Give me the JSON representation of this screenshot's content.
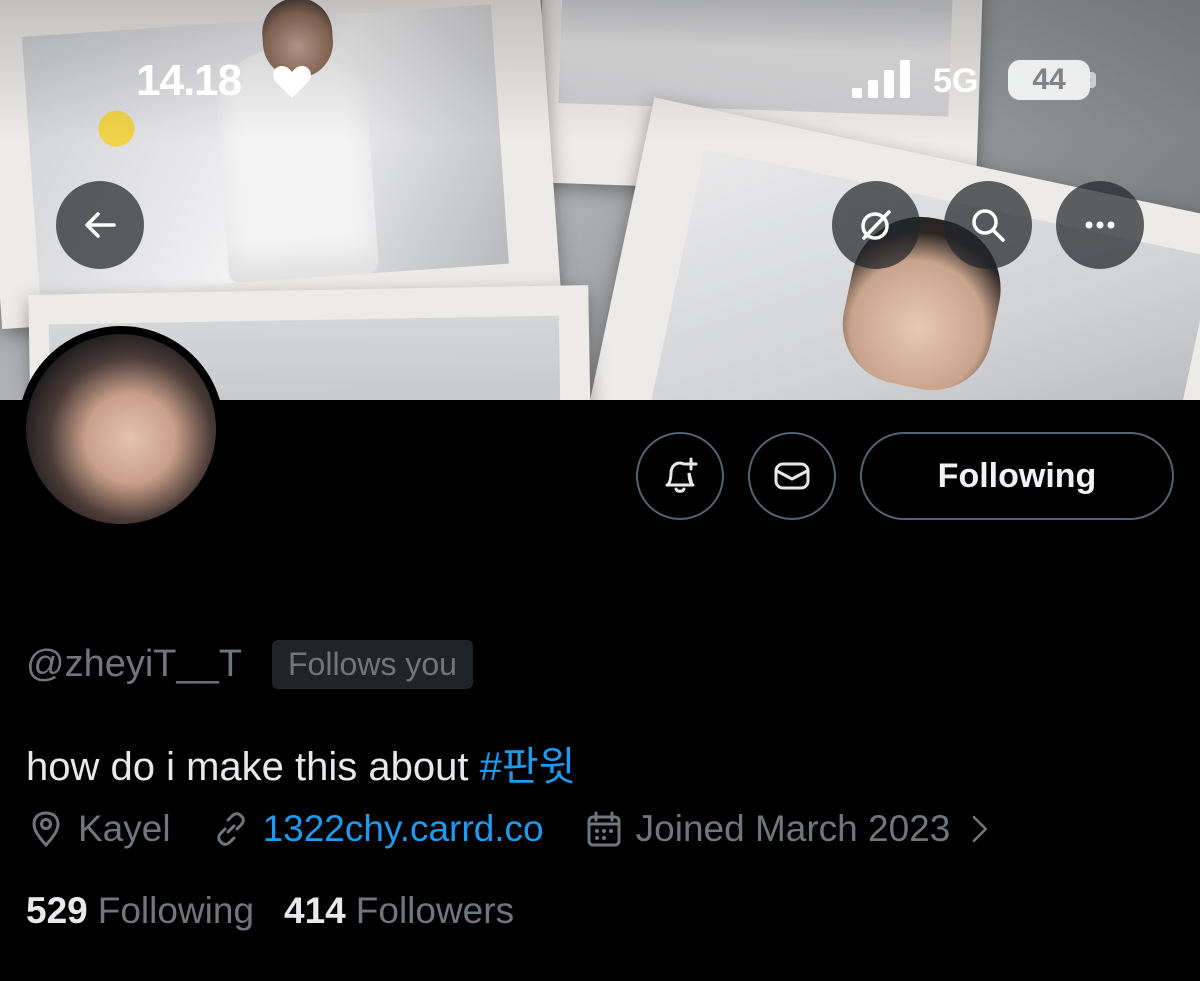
{
  "status_bar": {
    "time": "14.18",
    "network": "5G",
    "battery": "44",
    "icons": [
      "heart-icon",
      "signal-icon",
      "battery-icon"
    ]
  },
  "header": {
    "buttons": [
      "back-arrow-icon",
      "grok-icon",
      "search-icon",
      "more-icon"
    ]
  },
  "actions": {
    "notify_icon": "bell-plus-icon",
    "message_icon": "envelope-icon",
    "following_label": "Following"
  },
  "profile": {
    "handle": "@zheyiT__T",
    "follows_you": "Follows you",
    "bio_text": "how do i make this about ",
    "bio_hashtag": "#판윗",
    "location": "Kayel",
    "website": "1322chy.carrd.co",
    "joined": "Joined March 2023",
    "following_count": "529",
    "following_label": "Following",
    "followers_count": "414",
    "followers_label": "Followers"
  },
  "colors": {
    "background": "#000000",
    "text_primary": "#e7e9ea",
    "text_secondary": "#71767b",
    "accent": "#1d9bf0",
    "border": "#536471"
  }
}
